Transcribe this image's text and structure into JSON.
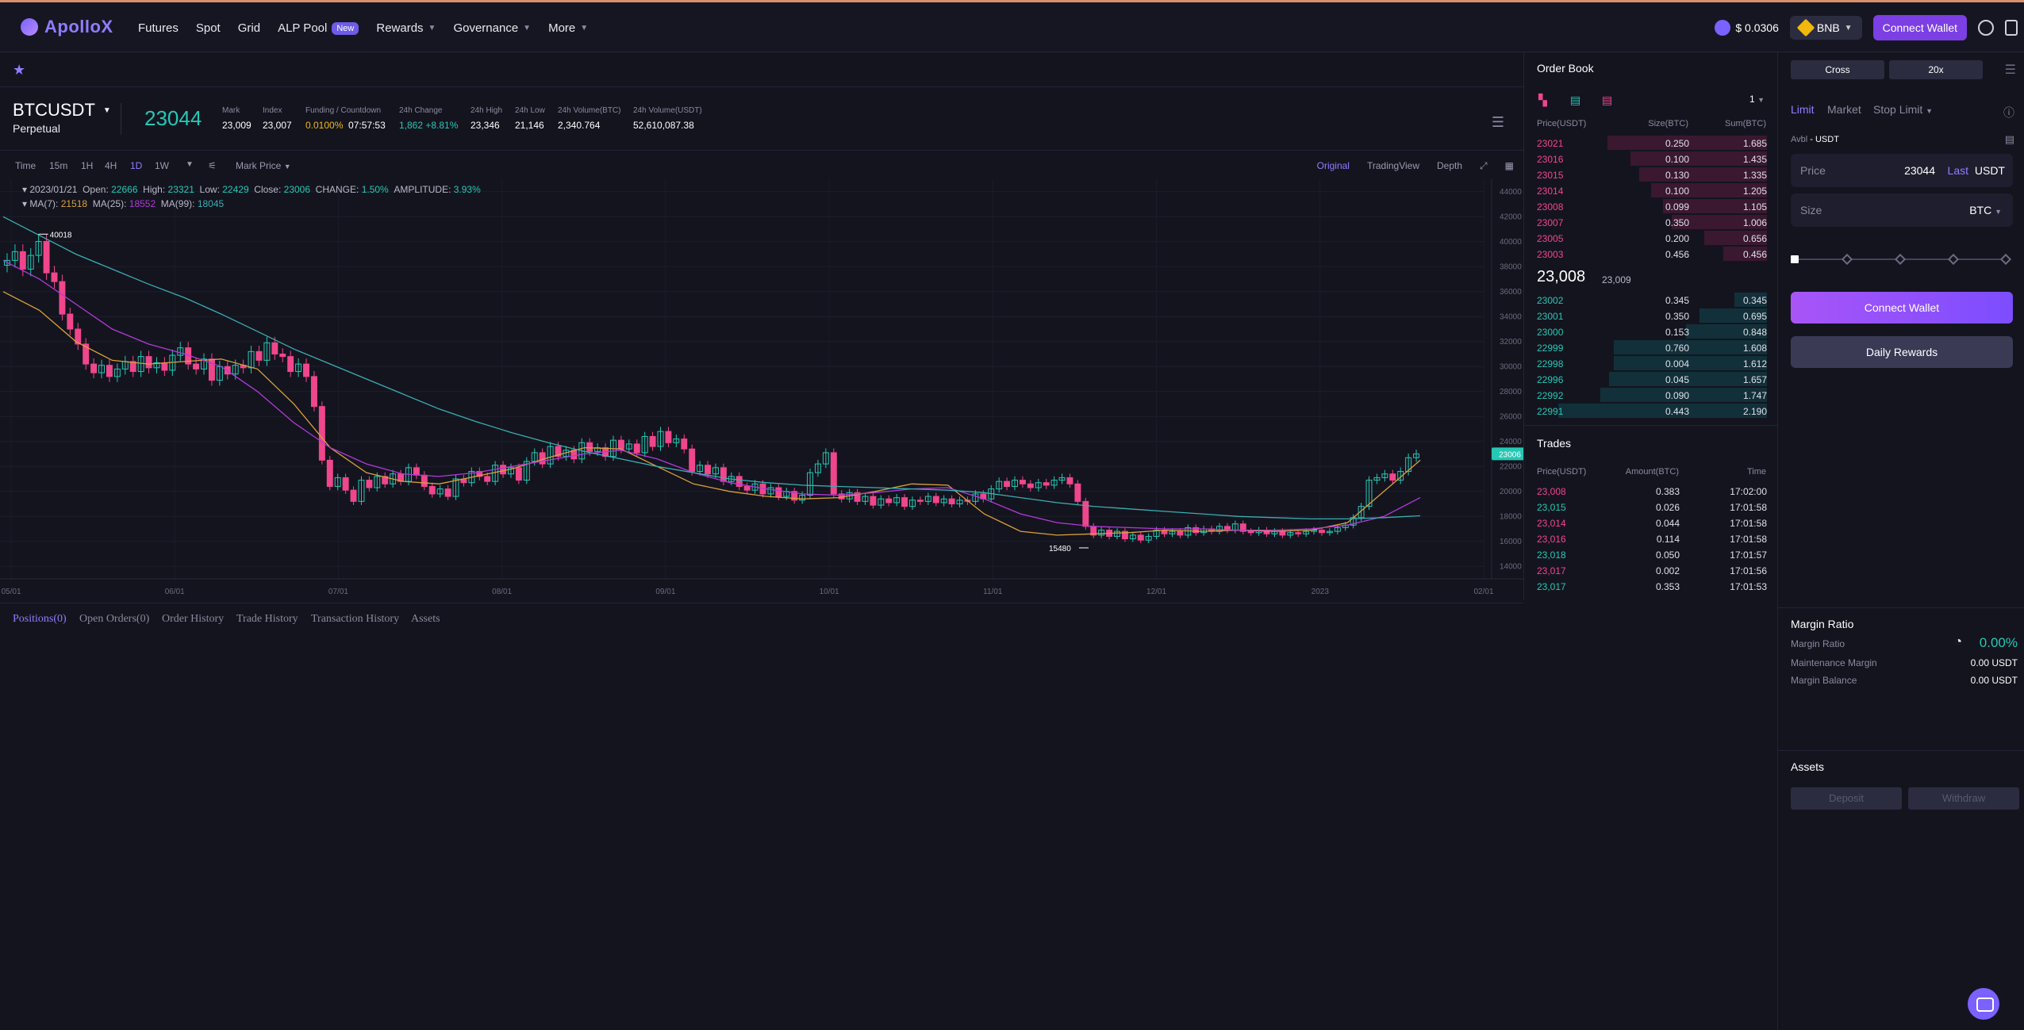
{
  "brand": {
    "name": "ApolloX"
  },
  "nav": {
    "items": [
      "Futures",
      "Spot",
      "Grid",
      "ALP Pool",
      "Rewards",
      "Governance",
      "More"
    ],
    "new_badge": "New"
  },
  "header": {
    "alp_price": "$ 0.0306",
    "network": "BNB",
    "connect_wallet": "Connect Wallet"
  },
  "ticker": {
    "symbol": "BTCUSDT",
    "contract": "Perpetual",
    "last_price": "23044",
    "stats": [
      {
        "label": "Mark",
        "value": "23,009"
      },
      {
        "label": "Index",
        "value": "23,007"
      },
      {
        "label": "Funding / Countdown",
        "value": "0.0100%",
        "value2": "07:57:53"
      },
      {
        "label": "24h Change",
        "value": "1,862 +8.81%"
      },
      {
        "label": "24h High",
        "value": "23,346"
      },
      {
        "label": "24h Low",
        "value": "21,146"
      },
      {
        "label": "24h Volume(BTC)",
        "value": "2,340.764"
      },
      {
        "label": "24h Volume(USDT)",
        "value": "52,610,087.38"
      }
    ]
  },
  "chart_toolbar": {
    "intervals": [
      "Time",
      "15m",
      "1H",
      "4H",
      "1D",
      "1W"
    ],
    "active_interval": "1D",
    "price_source": "Mark Price",
    "views": [
      "Original",
      "TradingView",
      "Depth"
    ],
    "active_view": "Original"
  },
  "chart_data": {
    "type": "candlestick",
    "ohlc_line": {
      "date": "2023/01/21",
      "open": "22666",
      "high": "23321",
      "low": "22429",
      "close": "23006",
      "change": "1.50%",
      "amplitude": "3.93%"
    },
    "ma": {
      "ma7": "21518",
      "ma25": "18552",
      "ma99": "18045"
    },
    "y_ticks": [
      44000,
      42000,
      40000,
      38000,
      36000,
      34000,
      32000,
      30000,
      28000,
      26000,
      24000,
      22000,
      20000,
      18000,
      16000,
      14000
    ],
    "x_ticks": [
      "05/01",
      "06/01",
      "07/01",
      "08/01",
      "09/01",
      "10/01",
      "11/01",
      "12/01",
      "2023",
      "02/01"
    ],
    "ylim": [
      13000,
      45000
    ],
    "annotations": {
      "high": "40018",
      "low": "15480",
      "current": "23006"
    },
    "close_series": [
      38500,
      39200,
      37800,
      38900,
      40018,
      37500,
      36800,
      34200,
      33000,
      31800,
      30200,
      29500,
      30100,
      29200,
      29800,
      30400,
      29600,
      30800,
      29900,
      30300,
      29700,
      30900,
      31500,
      30200,
      29800,
      30600,
      28900,
      30000,
      29400,
      30100,
      29900,
      31200,
      30500,
      31900,
      31000,
      30800,
      29600,
      30200,
      29200,
      26800,
      22500,
      20400,
      21100,
      20100,
      19200,
      20900,
      20300,
      21200,
      20600,
      21400,
      20800,
      21900,
      21300,
      20400,
      19800,
      20200,
      19600,
      21000,
      20700,
      21600,
      21200,
      20800,
      22100,
      21400,
      21900,
      20900,
      22400,
      23100,
      22200,
      23600,
      22800,
      23300,
      22600,
      23900,
      23200,
      23500,
      22800,
      24100,
      23400,
      23800,
      23100,
      24400,
      23600,
      24800,
      23900,
      24200,
      23400,
      21600,
      22100,
      21400,
      21900,
      20800,
      21200,
      20400,
      20100,
      20600,
      19800,
      20300,
      19600,
      20000,
      19300,
      19700,
      21500,
      22200,
      23100,
      19800,
      19400,
      19900,
      19200,
      19600,
      18900,
      19400,
      19100,
      19500,
      18800,
      19300,
      19200,
      19600,
      19100,
      19400,
      19000,
      19300,
      19200,
      19800,
      19400,
      20200,
      20800,
      20400,
      20900,
      20600,
      20300,
      20700,
      20500,
      20900,
      21100,
      20600,
      19200,
      17200,
      16500,
      16900,
      16400,
      16800,
      16200,
      16500,
      16100,
      16400,
      16900,
      16600,
      16800,
      16500,
      17100,
      16700,
      17000,
      16800,
      17200,
      16900,
      17400,
      16800,
      16700,
      16900,
      16600,
      16800,
      16500,
      16700,
      16600,
      16800,
      16900,
      16700,
      16800,
      17100,
      17300,
      17900,
      18800,
      20900,
      21100,
      21400,
      20900,
      21600,
      22700,
      23006
    ],
    "ma_series": {
      "ma7": [
        36000,
        34500,
        32000,
        30500,
        30200,
        30400,
        30600,
        29800,
        27000,
        23500,
        21500,
        20800,
        20600,
        21200,
        21800,
        22700,
        23500,
        23400,
        22000,
        20600,
        20000,
        19600,
        19400,
        19500,
        20000,
        20600,
        20500,
        18200,
        16800,
        16500,
        16600,
        16700,
        16900,
        16800,
        16900,
        16800,
        16900,
        17500,
        20000,
        22500
      ],
      "ma25": [
        38500,
        37000,
        35000,
        33000,
        31800,
        31000,
        30000,
        28000,
        25500,
        23500,
        22200,
        21400,
        21200,
        21500,
        22000,
        22500,
        23000,
        23300,
        22600,
        21500,
        20700,
        20200,
        19800,
        19700,
        19900,
        20200,
        20300,
        19400,
        18200,
        17500,
        17200,
        17100,
        17000,
        17000,
        16900,
        16900,
        17000,
        17300,
        18000,
        19500
      ],
      "ma99": [
        42000,
        40500,
        39000,
        37800,
        36600,
        35500,
        34200,
        32800,
        31400,
        30200,
        29000,
        27800,
        26600,
        25600,
        24700,
        23900,
        23200,
        22600,
        22000,
        21500,
        21000,
        20700,
        20500,
        20400,
        20300,
        20200,
        20100,
        19900,
        19500,
        19100,
        18800,
        18600,
        18400,
        18200,
        18000,
        17900,
        17800,
        17800,
        17900,
        18045
      ]
    }
  },
  "positions_tabs": [
    "Positions(0)",
    "Open Orders(0)",
    "Order History",
    "Trade History",
    "Transaction History",
    "Assets"
  ],
  "order_book": {
    "title": "Order Book",
    "precision": "1",
    "headers": [
      "Price(USDT)",
      "Size(BTC)",
      "Sum(BTC)"
    ],
    "asks": [
      {
        "price": "23021",
        "size": "0.250",
        "sum": "1.685",
        "depth": 0.69
      },
      {
        "price": "23016",
        "size": "0.100",
        "sum": "1.435",
        "depth": 0.59
      },
      {
        "price": "23015",
        "size": "0.130",
        "sum": "1.335",
        "depth": 0.55
      },
      {
        "price": "23014",
        "size": "0.100",
        "sum": "1.205",
        "depth": 0.5
      },
      {
        "price": "23008",
        "size": "0.099",
        "sum": "1.105",
        "depth": 0.45
      },
      {
        "price": "23007",
        "size": "0.350",
        "sum": "1.006",
        "depth": 0.41
      },
      {
        "price": "23005",
        "size": "0.200",
        "sum": "0.656",
        "depth": 0.27
      },
      {
        "price": "23003",
        "size": "0.456",
        "sum": "0.456",
        "depth": 0.19
      }
    ],
    "mid_price": "23,008",
    "mid_mark": "23,009",
    "bids": [
      {
        "price": "23002",
        "size": "0.345",
        "sum": "0.345",
        "depth": 0.14
      },
      {
        "price": "23001",
        "size": "0.350",
        "sum": "0.695",
        "depth": 0.29
      },
      {
        "price": "23000",
        "size": "0.153",
        "sum": "0.848",
        "depth": 0.35
      },
      {
        "price": "22999",
        "size": "0.760",
        "sum": "1.608",
        "depth": 0.66
      },
      {
        "price": "22998",
        "size": "0.004",
        "sum": "1.612",
        "depth": 0.66
      },
      {
        "price": "22996",
        "size": "0.045",
        "sum": "1.657",
        "depth": 0.68
      },
      {
        "price": "22992",
        "size": "0.090",
        "sum": "1.747",
        "depth": 0.72
      },
      {
        "price": "22991",
        "size": "0.443",
        "sum": "2.190",
        "depth": 0.9
      }
    ]
  },
  "trades": {
    "title": "Trades",
    "headers": [
      "Price(USDT)",
      "Amount(BTC)",
      "Time"
    ],
    "rows": [
      {
        "price": "23,008",
        "amount": "0.383",
        "time": "17:02:00",
        "side": "sell"
      },
      {
        "price": "23,015",
        "amount": "0.026",
        "time": "17:01:58",
        "side": "buy"
      },
      {
        "price": "23,014",
        "amount": "0.044",
        "time": "17:01:58",
        "side": "sell"
      },
      {
        "price": "23,016",
        "amount": "0.114",
        "time": "17:01:58",
        "side": "sell"
      },
      {
        "price": "23,018",
        "amount": "0.050",
        "time": "17:01:57",
        "side": "buy"
      },
      {
        "price": "23,017",
        "amount": "0.002",
        "time": "17:01:56",
        "side": "sell"
      },
      {
        "price": "23,017",
        "amount": "0.353",
        "time": "17:01:53",
        "side": "buy"
      }
    ]
  },
  "order_form": {
    "margin_mode": "Cross",
    "leverage": "20x",
    "order_types": [
      "Limit",
      "Market",
      "Stop Limit"
    ],
    "avbl_label": "Avbl",
    "avbl_value": "- USDT",
    "price_label": "Price",
    "price_value": "23044",
    "price_ref": "Last",
    "price_unit": "USDT",
    "size_label": "Size",
    "size_unit": "BTC",
    "slider_value": 0,
    "connect_wallet": "Connect Wallet",
    "daily_rewards": "Daily Rewards"
  },
  "margin_ratio": {
    "title": "Margin Ratio",
    "rows": [
      {
        "label": "Margin Ratio",
        "value": "0.00%"
      },
      {
        "label": "Maintenance Margin",
        "value": "0.00 USDT"
      },
      {
        "label": "Margin Balance",
        "value": "0.00 USDT"
      }
    ]
  },
  "assets": {
    "title": "Assets",
    "deposit": "Deposit",
    "withdraw": "Withdraw"
  },
  "colors": {
    "accent": "#8f7dff",
    "up": "#25c8b4",
    "down": "#f0468c",
    "ma7": "#d9a13a",
    "ma25": "#b23ad9",
    "ma99": "#3aaeb0",
    "background": "#14141f"
  }
}
